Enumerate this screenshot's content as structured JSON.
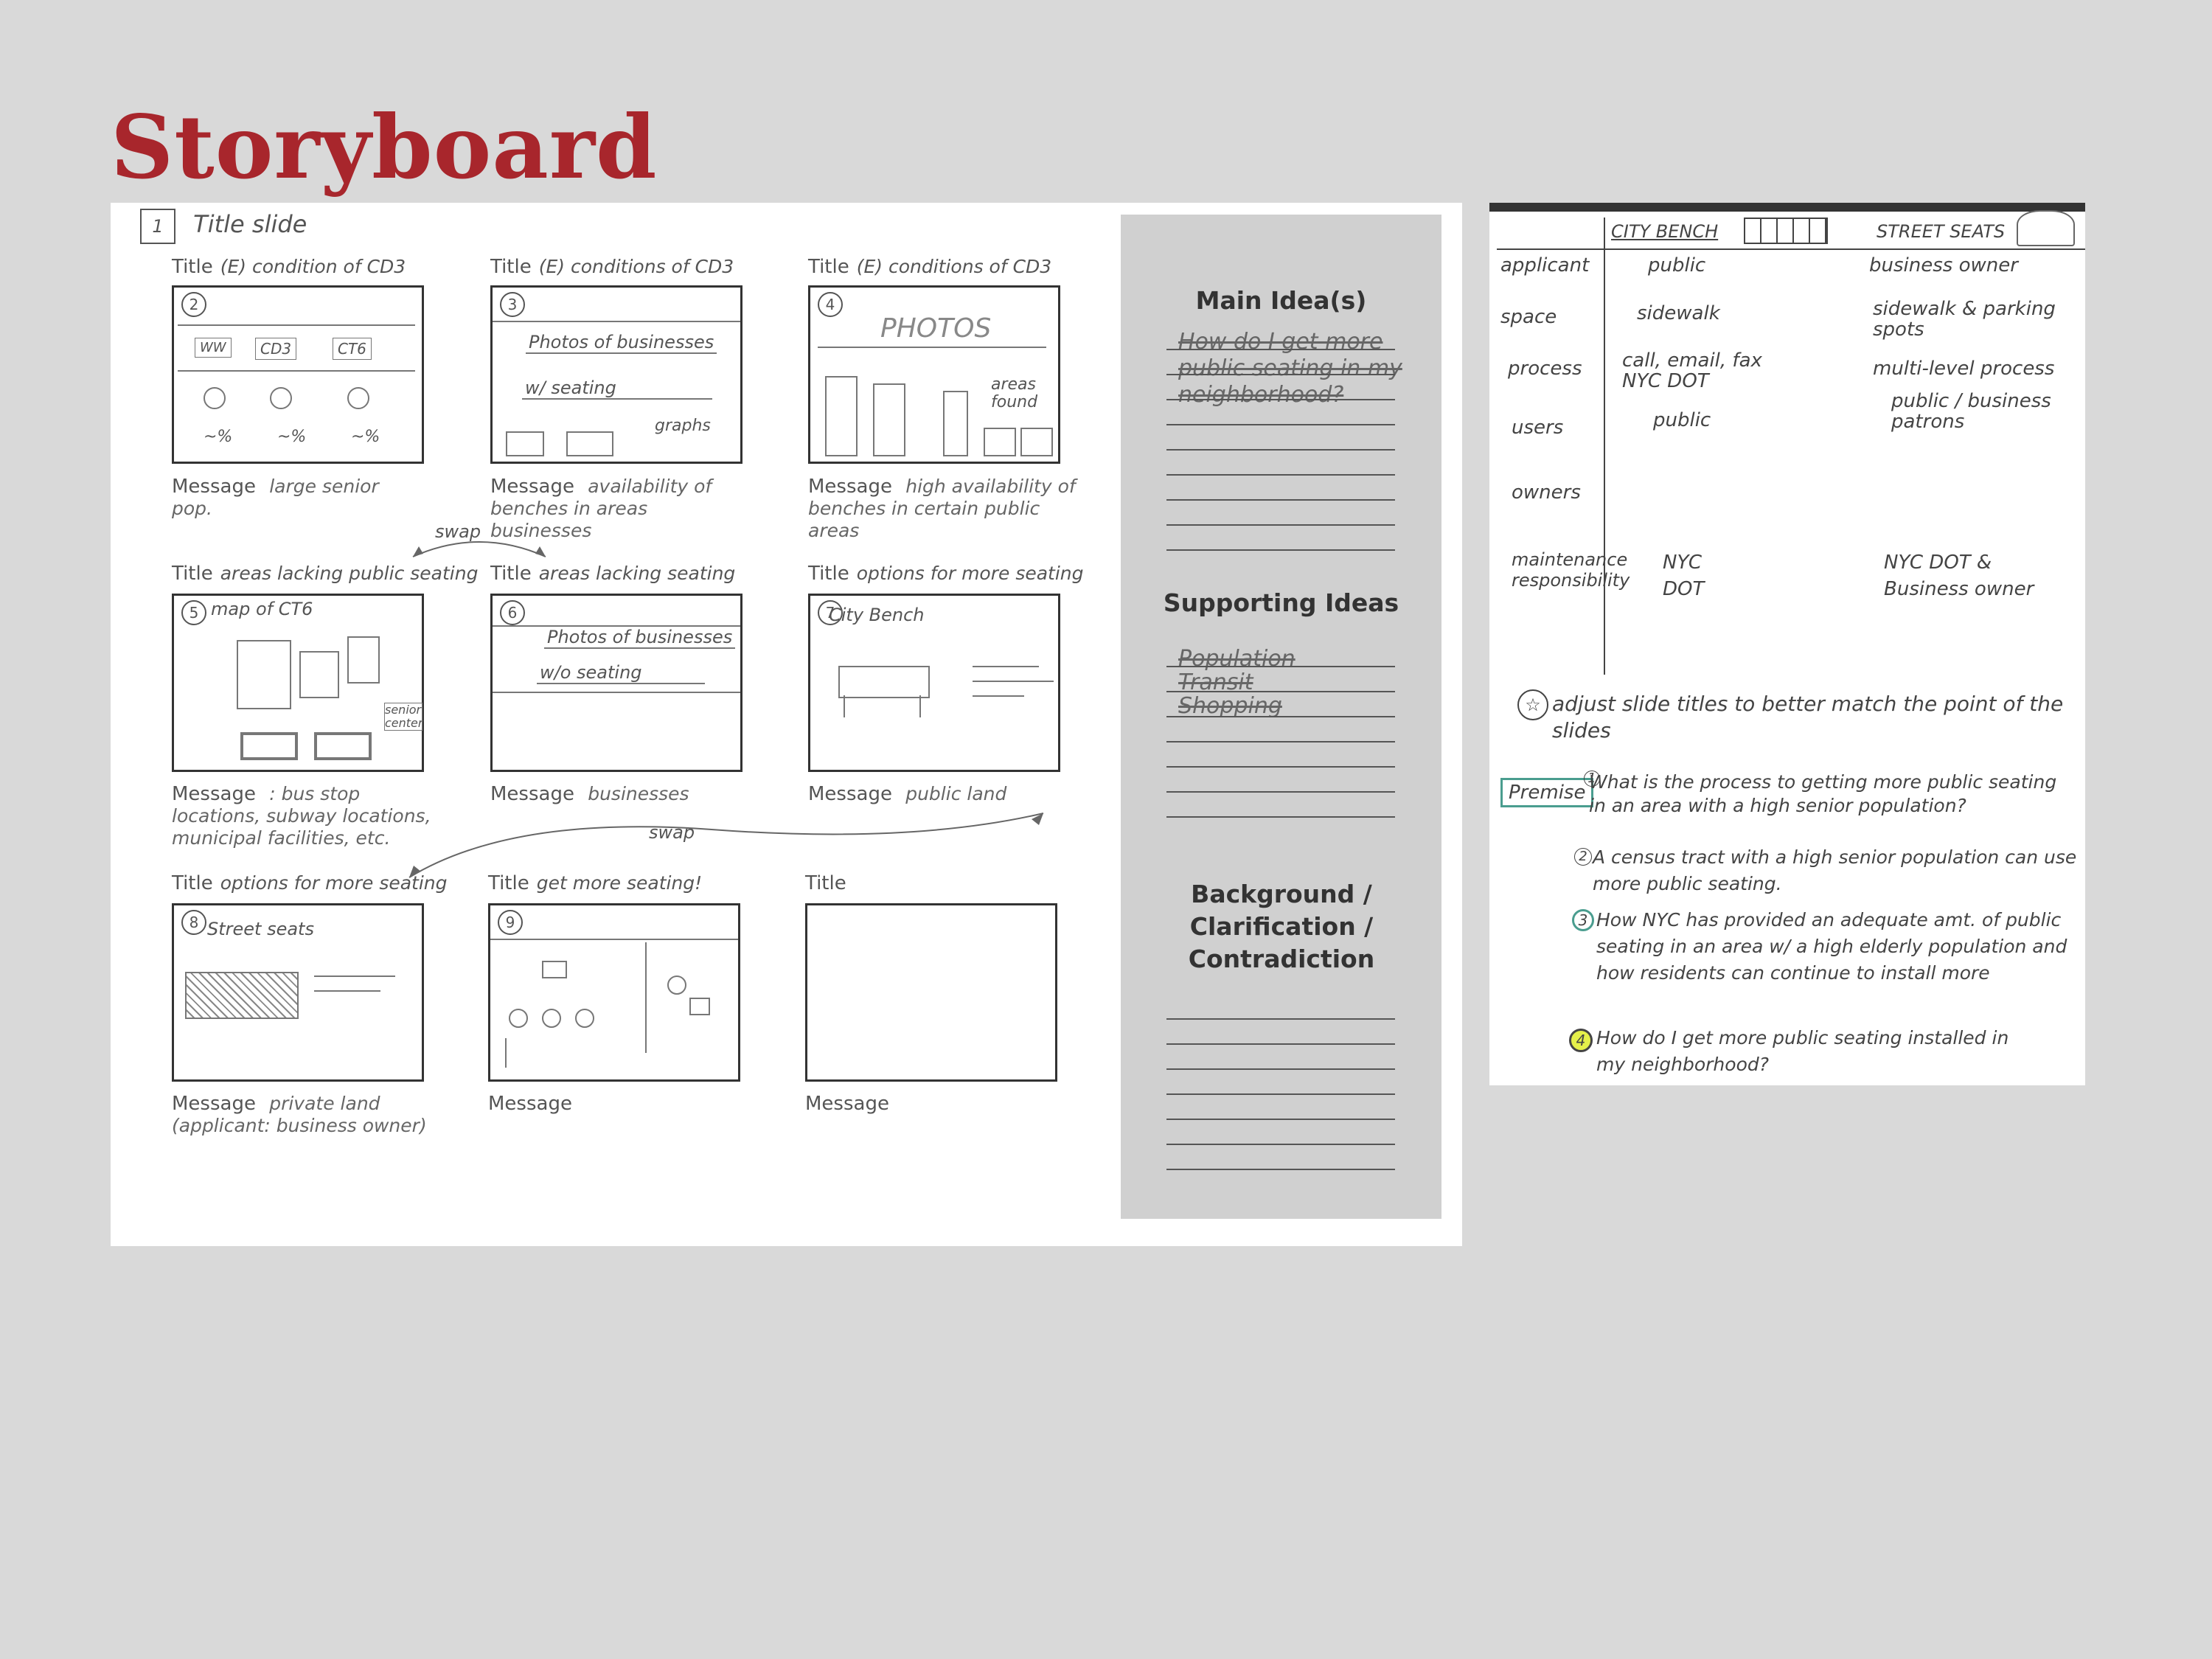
{
  "slide": {
    "title": "Storyboard"
  },
  "storyboard": {
    "title_slide_note": "Title slide",
    "title_label": "Title",
    "message_label": "Message",
    "panels": [
      {
        "num": "2",
        "title": "(E) condition of CD3",
        "message": "large senior pop.",
        "content": [
          "WW",
          "CD3",
          "CT6",
          "~%",
          "~%",
          "~%"
        ]
      },
      {
        "num": "3",
        "title": "(E) conditions of CD3",
        "message": "availability of benches in areas businesses",
        "content": [
          "Photos of businesses",
          "w/ seating",
          "graphs"
        ]
      },
      {
        "num": "4",
        "title": "(E) conditions of CD3",
        "message": "high availability of benches in certain public areas",
        "content": [
          "PHOTOS",
          "areas found"
        ]
      },
      {
        "num": "5",
        "title": "areas lacking public seating",
        "message": ": bus stop locations, subway locations, municipal facilities, etc.",
        "content": [
          "map of CT6",
          "senior center"
        ]
      },
      {
        "num": "6",
        "title": "areas lacking seating",
        "message": "businesses",
        "content": [
          "Photos of businesses",
          "w/o seating"
        ]
      },
      {
        "num": "7",
        "title": "options for more seating",
        "message": "public land",
        "content": [
          "City Bench"
        ]
      },
      {
        "num": "8",
        "title": "options for more seating",
        "message": "private land (applicant: business owner)",
        "content": [
          "Street seats"
        ]
      },
      {
        "num": "9",
        "title": "get more seating!",
        "message": "",
        "content": []
      },
      {
        "num": "",
        "title": "",
        "message": "",
        "content": []
      }
    ],
    "swap_label": "swap",
    "sidebar": {
      "main_ideas_heading": "Main Idea(s)",
      "main_ideas_text": "How do I get more public seating in my neighborhood?",
      "supporting_heading": "Supporting Ideas",
      "supporting_items": [
        "Population",
        "Transit",
        "Shopping"
      ],
      "background_heading": "Background / Clarification / Contradiction"
    }
  },
  "notes": {
    "col1_header": "CITY BENCH",
    "col2_header": "STREET SEATS",
    "rows": [
      {
        "label": "applicant",
        "city": "public",
        "street": "business owner"
      },
      {
        "label": "space",
        "city": "sidewalk",
        "street": "sidewalk & parking spots"
      },
      {
        "label": "process",
        "city": "call, email, fax NYC DOT",
        "street": "multi-level process"
      },
      {
        "label": "users",
        "city": "public",
        "street": "public / business patrons"
      },
      {
        "label": "owners",
        "city": "",
        "street": ""
      },
      {
        "label": "maintenance responsibility",
        "city": "NYC DOT",
        "street": "NYC DOT & Business owner"
      }
    ],
    "star_note": "adjust slide titles to better match the point of the slides",
    "premise_label": "Premise",
    "premises": [
      {
        "n": "1",
        "text": "What is the process to getting more public seating in an area with a high senior population?"
      },
      {
        "n": "2",
        "text": "A census tract with a high senior population can use more public seating."
      },
      {
        "n": "3",
        "text": "How NYC has provided an adequate amt. of public seating in an area w/ a high elderly population and how residents can continue to install more"
      },
      {
        "n": "4",
        "text": "How do I get more public seating installed in my neighborhood?"
      }
    ]
  }
}
